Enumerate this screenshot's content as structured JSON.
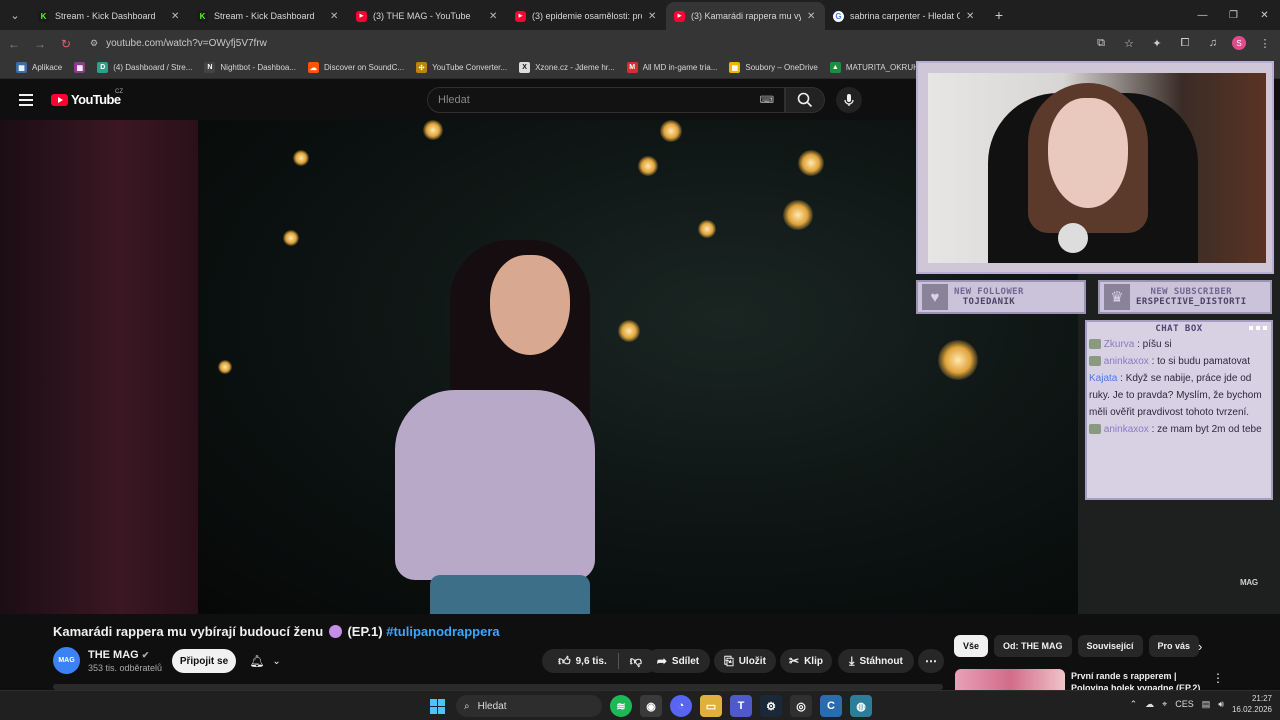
{
  "browser": {
    "tabs": [
      {
        "title": "Stream - Kick Dashboard",
        "favicon": "kick-icon"
      },
      {
        "title": "Stream - Kick Dashboard",
        "favicon": "kick-icon"
      },
      {
        "title": "(3) THE MAG - YouTube",
        "favicon": "youtube-icon"
      },
      {
        "title": "(3) epidemie osamělosti: proč s...",
        "favicon": "youtube-icon"
      },
      {
        "title": "(3) Kamarádi rappera mu vybíra...",
        "favicon": "youtube-icon",
        "active": true
      },
      {
        "title": "sabrina carpenter - Hledat Goo...",
        "favicon": "google-icon"
      }
    ],
    "url": "youtube.com/watch?v=OWyfj5V7frw",
    "bookmarks": [
      {
        "label": "Aplikace",
        "icon": "apps-grid-icon"
      },
      {
        "label": "(4) Dashboard / Stre...",
        "icon": "dashboard-icon"
      },
      {
        "label": "Nightbot - Dashboa...",
        "icon": "nightbot-icon"
      },
      {
        "label": "Discover on SoundC...",
        "icon": "soundcloud-icon"
      },
      {
        "label": "YouTube Converter...",
        "icon": "converter-icon"
      },
      {
        "label": "Xzone.cz - Jdeme hr...",
        "icon": "xzone-icon"
      },
      {
        "label": "All MD in-game tria...",
        "icon": "md-icon"
      },
      {
        "label": "Soubory – OneDrive",
        "icon": "onedrive-icon"
      },
      {
        "label": "MATURITA_OKRUH...",
        "icon": "drive-icon"
      }
    ],
    "profile_initial": "S"
  },
  "youtube": {
    "logo_text": "YouTube",
    "country": "CZ",
    "search_placeholder": "Hledat",
    "video": {
      "title_main": "Kamarádi rappera mu vybírají budoucí ženu",
      "title_ep": "(EP.1)",
      "hashtag": "#tulipanodrappera",
      "watermark": "MAG"
    },
    "channel": {
      "avatar_text": "MAG",
      "name": "THE MAG",
      "subscribers": "353 tis. odběratelů",
      "join_label": "Připojit se"
    },
    "actions": {
      "likes": "9,6 tis.",
      "share": "Sdílet",
      "save": "Uložit",
      "clip": "Klip",
      "download": "Stáhnout"
    },
    "chips": [
      "Vše",
      "Od: THE MAG",
      "Související",
      "Pro vás"
    ],
    "recommendation": {
      "title": "První rande s rapperem | Polovina holek vypadne (EP.2)"
    }
  },
  "overlay": {
    "alerts": [
      {
        "heading": "NEW FOLLOWER",
        "name": "TOJEDANIK"
      },
      {
        "heading": "NEW SUBSCRIBER",
        "name": "ERSPECTIVE_DISTORTI"
      }
    ],
    "chat": {
      "title": "CHAT BOX",
      "messages": [
        {
          "user": "Zkurva",
          "text": ": píšu si",
          "user_color": "#8a7bc2"
        },
        {
          "user": "aninkaxox",
          "text": ": to si budu pamatovat",
          "user_color": "#8a7bc2"
        },
        {
          "user": "Kajata",
          "text": ": Když se nabije, práce jde od ruky. Je to pravda? Myslím, že bychom měli ověřit pravdivost tohoto tvrzení.",
          "user_color": "#4a7ce0"
        },
        {
          "user": "aninkaxox",
          "text": ": ze mam byt 2m od tebe",
          "user_color": "#8a7bc2"
        }
      ]
    }
  },
  "taskbar": {
    "search_label": "Hledat",
    "language": "CES",
    "time": "21:27",
    "date": "16.02.2026"
  },
  "colors": {
    "yt_red": "#ff0033",
    "link_blue": "#3ea6ff",
    "overlay_lilac": "#cbc3d9"
  }
}
